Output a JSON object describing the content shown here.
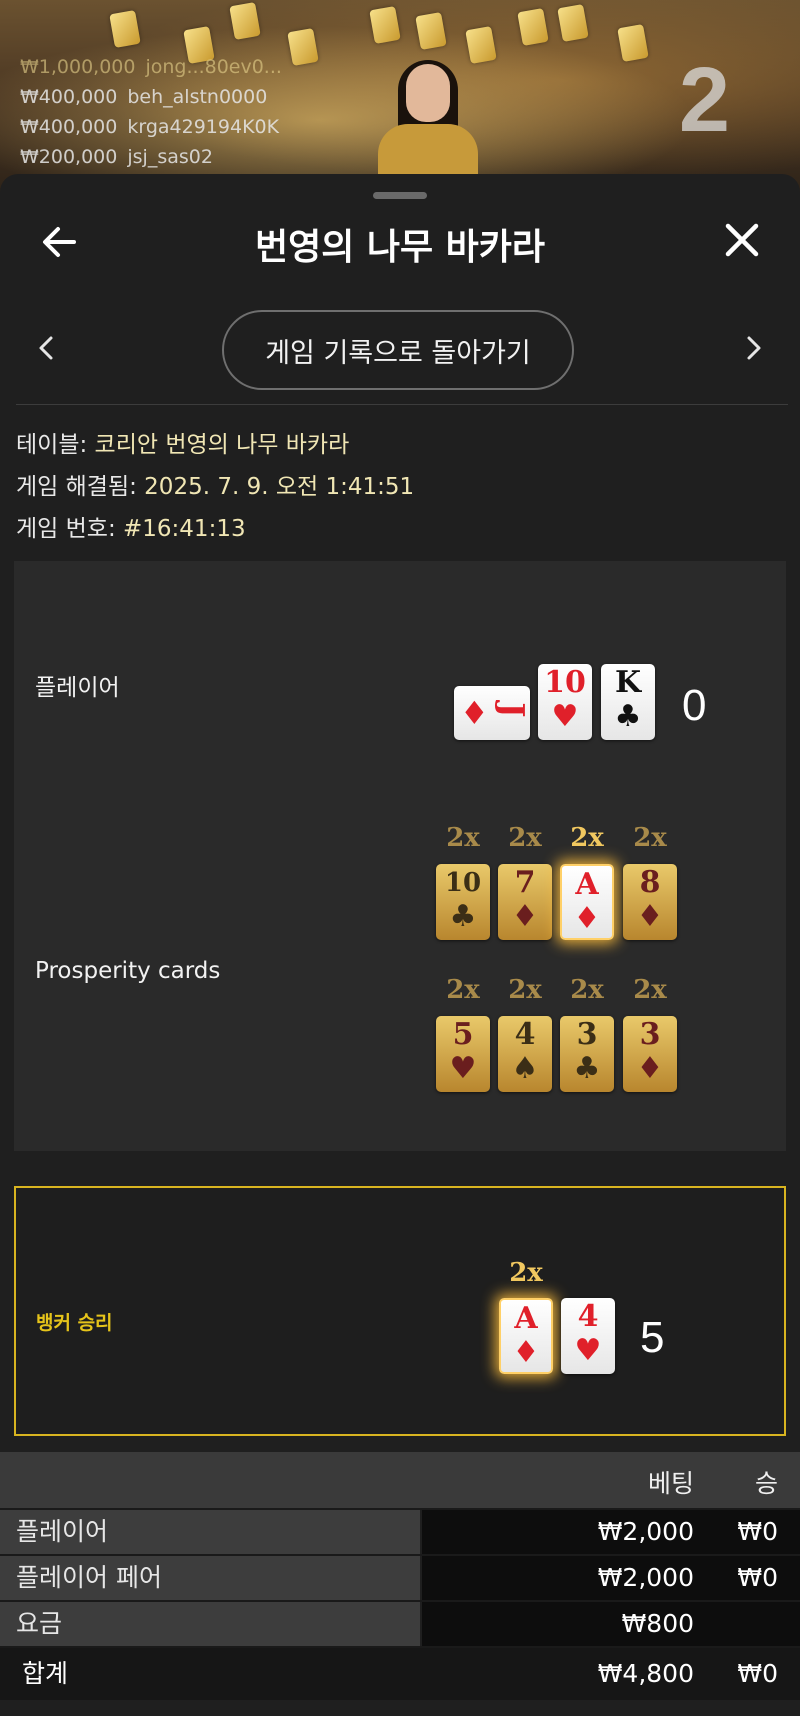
{
  "live_feed": {
    "round_number": "2",
    "bets": [
      {
        "amount": "₩1,000,000",
        "user": "jong...80ev0..."
      },
      {
        "amount": "₩400,000",
        "user": "beh_alstn0000"
      },
      {
        "amount": "₩400,000",
        "user": "krga429194K0K"
      },
      {
        "amount": "₩200,000",
        "user": "jsj_sas02"
      }
    ]
  },
  "header": {
    "title": "번영의 나무 바카라",
    "back_icon": "arrow-left-icon",
    "close_icon": "close-icon"
  },
  "nav": {
    "back_to_history": "게임 기록으로 돌아가기",
    "prev_icon": "chevron-left-icon",
    "next_icon": "chevron-right-icon"
  },
  "info": {
    "table_label": "테이블: ",
    "table_value": "코리안 번영의 나무 바카라",
    "resolved_label": "게임 해결됨: ",
    "resolved_value": "2025. 7. 9. 오전 1:41:51",
    "game_no_label": "게임 번호: ",
    "game_no_value": "#16:41:13"
  },
  "player": {
    "label": "플레이어",
    "score": "0",
    "cards": [
      {
        "rank": "J",
        "suit": "♦",
        "color": "red",
        "sideways": true
      },
      {
        "rank": "10",
        "suit": "♥",
        "color": "red"
      },
      {
        "rank": "K",
        "suit": "♣",
        "color": "black"
      }
    ]
  },
  "prosperity": {
    "label": "Prosperity cards",
    "row1": [
      {
        "mult": "2x",
        "rank": "10",
        "suit": "♣",
        "highlight": false
      },
      {
        "mult": "2x",
        "rank": "7",
        "suit": "♦",
        "highlight": false
      },
      {
        "mult": "2x",
        "rank": "A",
        "suit": "♦",
        "highlight": true
      },
      {
        "mult": "2x",
        "rank": "8",
        "suit": "♦",
        "highlight": false
      }
    ],
    "row2": [
      {
        "mult": "2x",
        "rank": "5",
        "suit": "♥",
        "highlight": false
      },
      {
        "mult": "2x",
        "rank": "4",
        "suit": "♠",
        "highlight": false
      },
      {
        "mult": "2x",
        "rank": "3",
        "suit": "♣",
        "highlight": false
      },
      {
        "mult": "2x",
        "rank": "3",
        "suit": "♦",
        "highlight": false
      }
    ]
  },
  "banker": {
    "label": "뱅커 승리",
    "score": "5",
    "mult": "2x",
    "cards": [
      {
        "rank": "A",
        "suit": "♦",
        "color": "red",
        "highlight": true
      },
      {
        "rank": "4",
        "suit": "♥",
        "color": "red"
      }
    ]
  },
  "bets_table": {
    "col_bet": "베팅",
    "col_win": "승",
    "rows": [
      {
        "name": "플레이어",
        "bet": "₩2,000",
        "win": "₩0"
      },
      {
        "name": "플레이어 페어",
        "bet": "₩2,000",
        "win": "₩0"
      },
      {
        "name": "요금",
        "bet": "₩800",
        "win": ""
      }
    ],
    "total": {
      "name": "합계",
      "bet": "₩4,800",
      "win": "₩0"
    }
  },
  "colors": {
    "accent_gold": "#d8b420",
    "sheet_bg": "#1f1f1f",
    "info_value": "#f0e6b4"
  }
}
